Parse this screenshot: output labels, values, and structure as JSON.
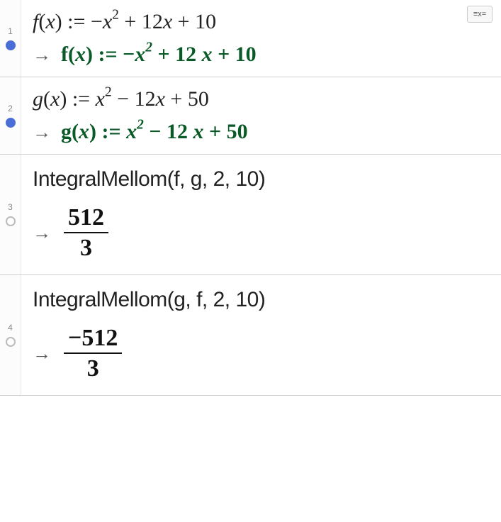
{
  "toolbar": {
    "numeric_btn": "x="
  },
  "rows": [
    {
      "num": "1",
      "input_html": "<span class='it'>f</span>(<span class='it'>x</span>) := −<span class='it'>x</span><sup>2</sup> + 12<span class='it'>x</span> + 10",
      "output_html": "<span class='fn'>f</span><span class='op'>(</span>x<span class='op'>)</span> <span class='op'>:=</span> <span class='op'>−</span>x<sup>2</sup> <span class='op'>+</span> <span class='op'>12</span> x <span class='op'>+</span> <span class='op'>10</span>",
      "filled": true
    },
    {
      "num": "2",
      "input_html": "<span class='it'>g</span>(<span class='it'>x</span>) := <span class='it'>x</span><sup>2</sup> − 12<span class='it'>x</span> + 50",
      "output_html": "<span class='fn'>g</span><span class='op'>(</span>x<span class='op'>)</span> <span class='op'>:=</span> x<sup>2</sup> <span class='op'>−</span> <span class='op'>12</span> x <span class='op'>+</span> <span class='op'>50</span>",
      "filled": true
    },
    {
      "num": "3",
      "input_text": "IntegralMellom(f, g, 2, 10)",
      "frac_num": "512",
      "frac_den": "3",
      "filled": false
    },
    {
      "num": "4",
      "input_text": "IntegralMellom(g, f, 2, 10)",
      "frac_num": "−512",
      "frac_den": "3",
      "filled": false
    }
  ]
}
